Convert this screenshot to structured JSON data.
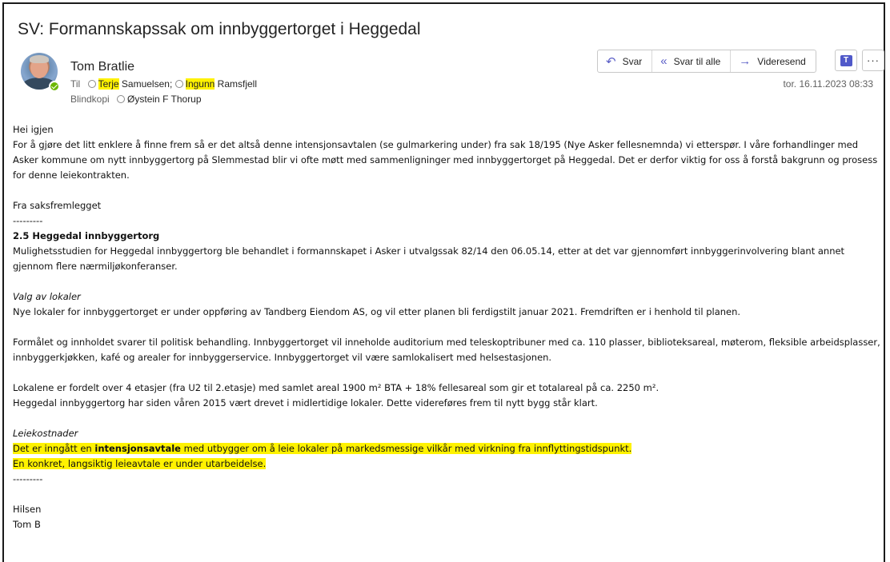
{
  "email": {
    "subject": "SV: Formannskapssak om innbyggertorget i Heggedal",
    "sender": "Tom Bratlie",
    "to_label": "Til",
    "to": [
      {
        "first": "Terje",
        "last": " Samuelsen;"
      },
      {
        "first": "Ingunn",
        "last": " Ramsfjell"
      }
    ],
    "bcc_label": "Blindkopi",
    "bcc": "Øystein F Thorup",
    "date": "tor. 16.11.2023 08:33"
  },
  "actions": {
    "reply": "Svar",
    "reply_all": "Svar til alle",
    "forward": "Videresend",
    "teams_letter": "T",
    "more": "···"
  },
  "icons": {
    "reply": "reply-arrow-icon",
    "reply_all": "reply-all-arrow-icon",
    "forward": "forward-arrow-icon",
    "teams": "teams-icon",
    "more": "more-options-icon",
    "presence": "presence-available-icon"
  },
  "colors": {
    "highlight": "#fff200",
    "accent": "#5b5fc7",
    "presence": "#6bb700"
  },
  "body": {
    "greeting": "Hei igjen",
    "p1": "For å gjøre det litt enklere å finne frem så er det altså denne intensjonsavtalen (se gulmarkering under) fra sak 18/195 (Nye Asker fellesnemnda) vi etterspør. I våre forhandlinger med Asker kommune om nytt innbyggertorg på Slemmestad blir vi ofte møtt med sammenligninger med innbyggertorget på Heggedal. Det er derfor viktig for oss å forstå bakgrunn og prosess for denne leiekontrakten.",
    "from_doc": "Fra saksfremlegget",
    "sep": "---------",
    "heading": "2.5 Heggedal innbyggertorg",
    "p2": "Mulighetsstudien for Heggedal innbyggertorg ble behandlet i formannskapet i Asker i utvalgssak 82/14 den 06.05.14, etter at det var gjennomført innbyggerinvolvering blant annet gjennom flere nærmiljøkonferanser.",
    "sub1": "Valg av lokaler",
    "p3": "Nye lokaler for innbyggertorget er under oppføring av Tandberg Eiendom AS, og vil etter planen bli ferdigstilt januar 2021. Fremdriften er i henhold til planen.",
    "p4": "Formålet og innholdet svarer til politisk behandling. Innbyggertorget vil inneholde auditorium med teleskoptribuner med ca. 110 plasser, biblioteksareal, møterom, fleksible arbeidsplasser, innbyggerkjøkken, kafé og arealer for innbyggerservice. Innbyggertorget vil være samlokalisert med helsestasjonen.",
    "p5a": "Lokalene er fordelt over 4 etasjer (fra U2 til 2.etasje) med samlet areal 1900 m² BTA + 18% fellesareal som gir et totalareal på ca. 2250 m².",
    "p5b": "Heggedal innbyggertorg har siden våren 2015 vært drevet i midlertidige lokaler. Dette videreføres frem til nytt bygg står klart.",
    "sub2": "Leiekostnader",
    "hl1_pre": "Det er inngått en ",
    "hl1_bold": "intensjonsavtale",
    "hl1_post": " med utbygger om å leie lokaler på markedsmessige vilkår med virkning fra innflyttingstidspunkt.",
    "hl2": "En konkret, langsiktig leieavtale er under utarbeidelse.",
    "sep2": "---------",
    "closing": "Hilsen",
    "signature": "Tom B"
  }
}
